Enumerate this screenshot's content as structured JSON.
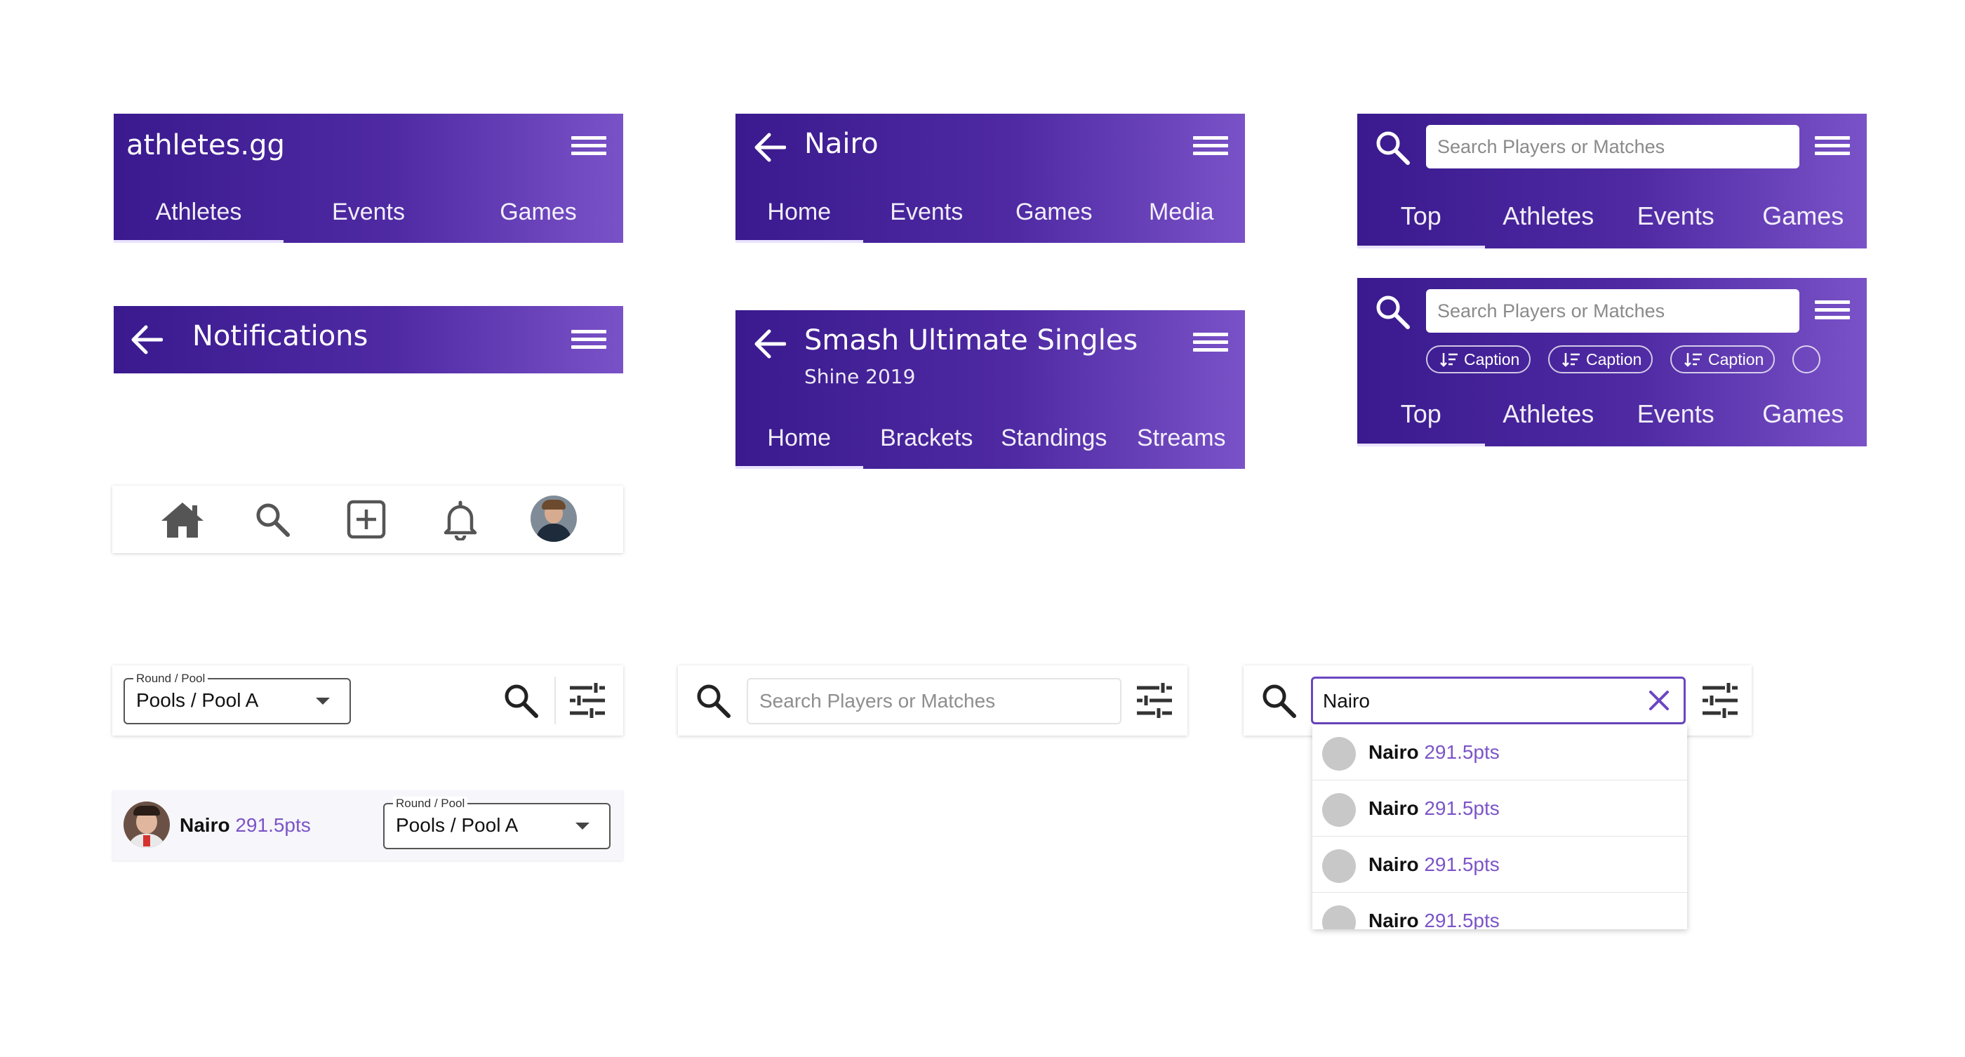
{
  "colors": {
    "bar_gradient_start": "#3a1a8e",
    "bar_gradient_end": "#7a52c8",
    "accent_purple": "#7b55c7",
    "search_focus_border": "#6b46c1"
  },
  "bar_home": {
    "title": "athletes.gg",
    "menu_icon": "hamburger-icon",
    "tabs": [
      "Athletes",
      "Events",
      "Games"
    ],
    "active_tab": "Athletes"
  },
  "bar_notifications": {
    "back_icon": "arrow-left-icon",
    "title": "Notifications",
    "menu_icon": "hamburger-icon"
  },
  "bottom_nav": {
    "items": [
      "home-icon",
      "search-icon",
      "add-box-icon",
      "bell-icon",
      "profile-avatar"
    ]
  },
  "bar_profile": {
    "back_icon": "arrow-left-icon",
    "title": "Nairo",
    "menu_icon": "hamburger-icon",
    "tabs": [
      "Home",
      "Events",
      "Games",
      "Media"
    ],
    "active_tab": "Home"
  },
  "bar_event": {
    "back_icon": "arrow-left-icon",
    "title": "Smash Ultimate Singles",
    "subtitle": "Shine 2019",
    "menu_icon": "hamburger-icon",
    "tabs": [
      "Home",
      "Brackets",
      "Standings",
      "Streams"
    ],
    "active_tab": "Home"
  },
  "bar_search": {
    "placeholder": "Search Players or Matches",
    "tabs": [
      "Top",
      "Athletes",
      "Events",
      "Games"
    ],
    "active_tab": "Top"
  },
  "bar_search_chips": {
    "placeholder": "Search Players or Matches",
    "chips": [
      "Caption",
      "Caption",
      "Caption"
    ],
    "tabs": [
      "Top",
      "Athletes",
      "Events",
      "Games"
    ],
    "active_tab": "Top"
  },
  "filter_bar": {
    "select_label": "Round / Pool",
    "select_value": "Pools / Pool A"
  },
  "player_row": {
    "name": "Nairo",
    "points": "291.5pts",
    "select_label": "Round / Pool",
    "select_value": "Pools / Pool A"
  },
  "search_bar_empty": {
    "placeholder": "Search Players or Matches"
  },
  "search_bar_active": {
    "value": "Nairo",
    "results": [
      {
        "name": "Nairo",
        "points": "291.5pts"
      },
      {
        "name": "Nairo",
        "points": "291.5pts"
      },
      {
        "name": "Nairo",
        "points": "291.5pts"
      },
      {
        "name": "Nairo",
        "points": "291.5pts"
      }
    ]
  }
}
